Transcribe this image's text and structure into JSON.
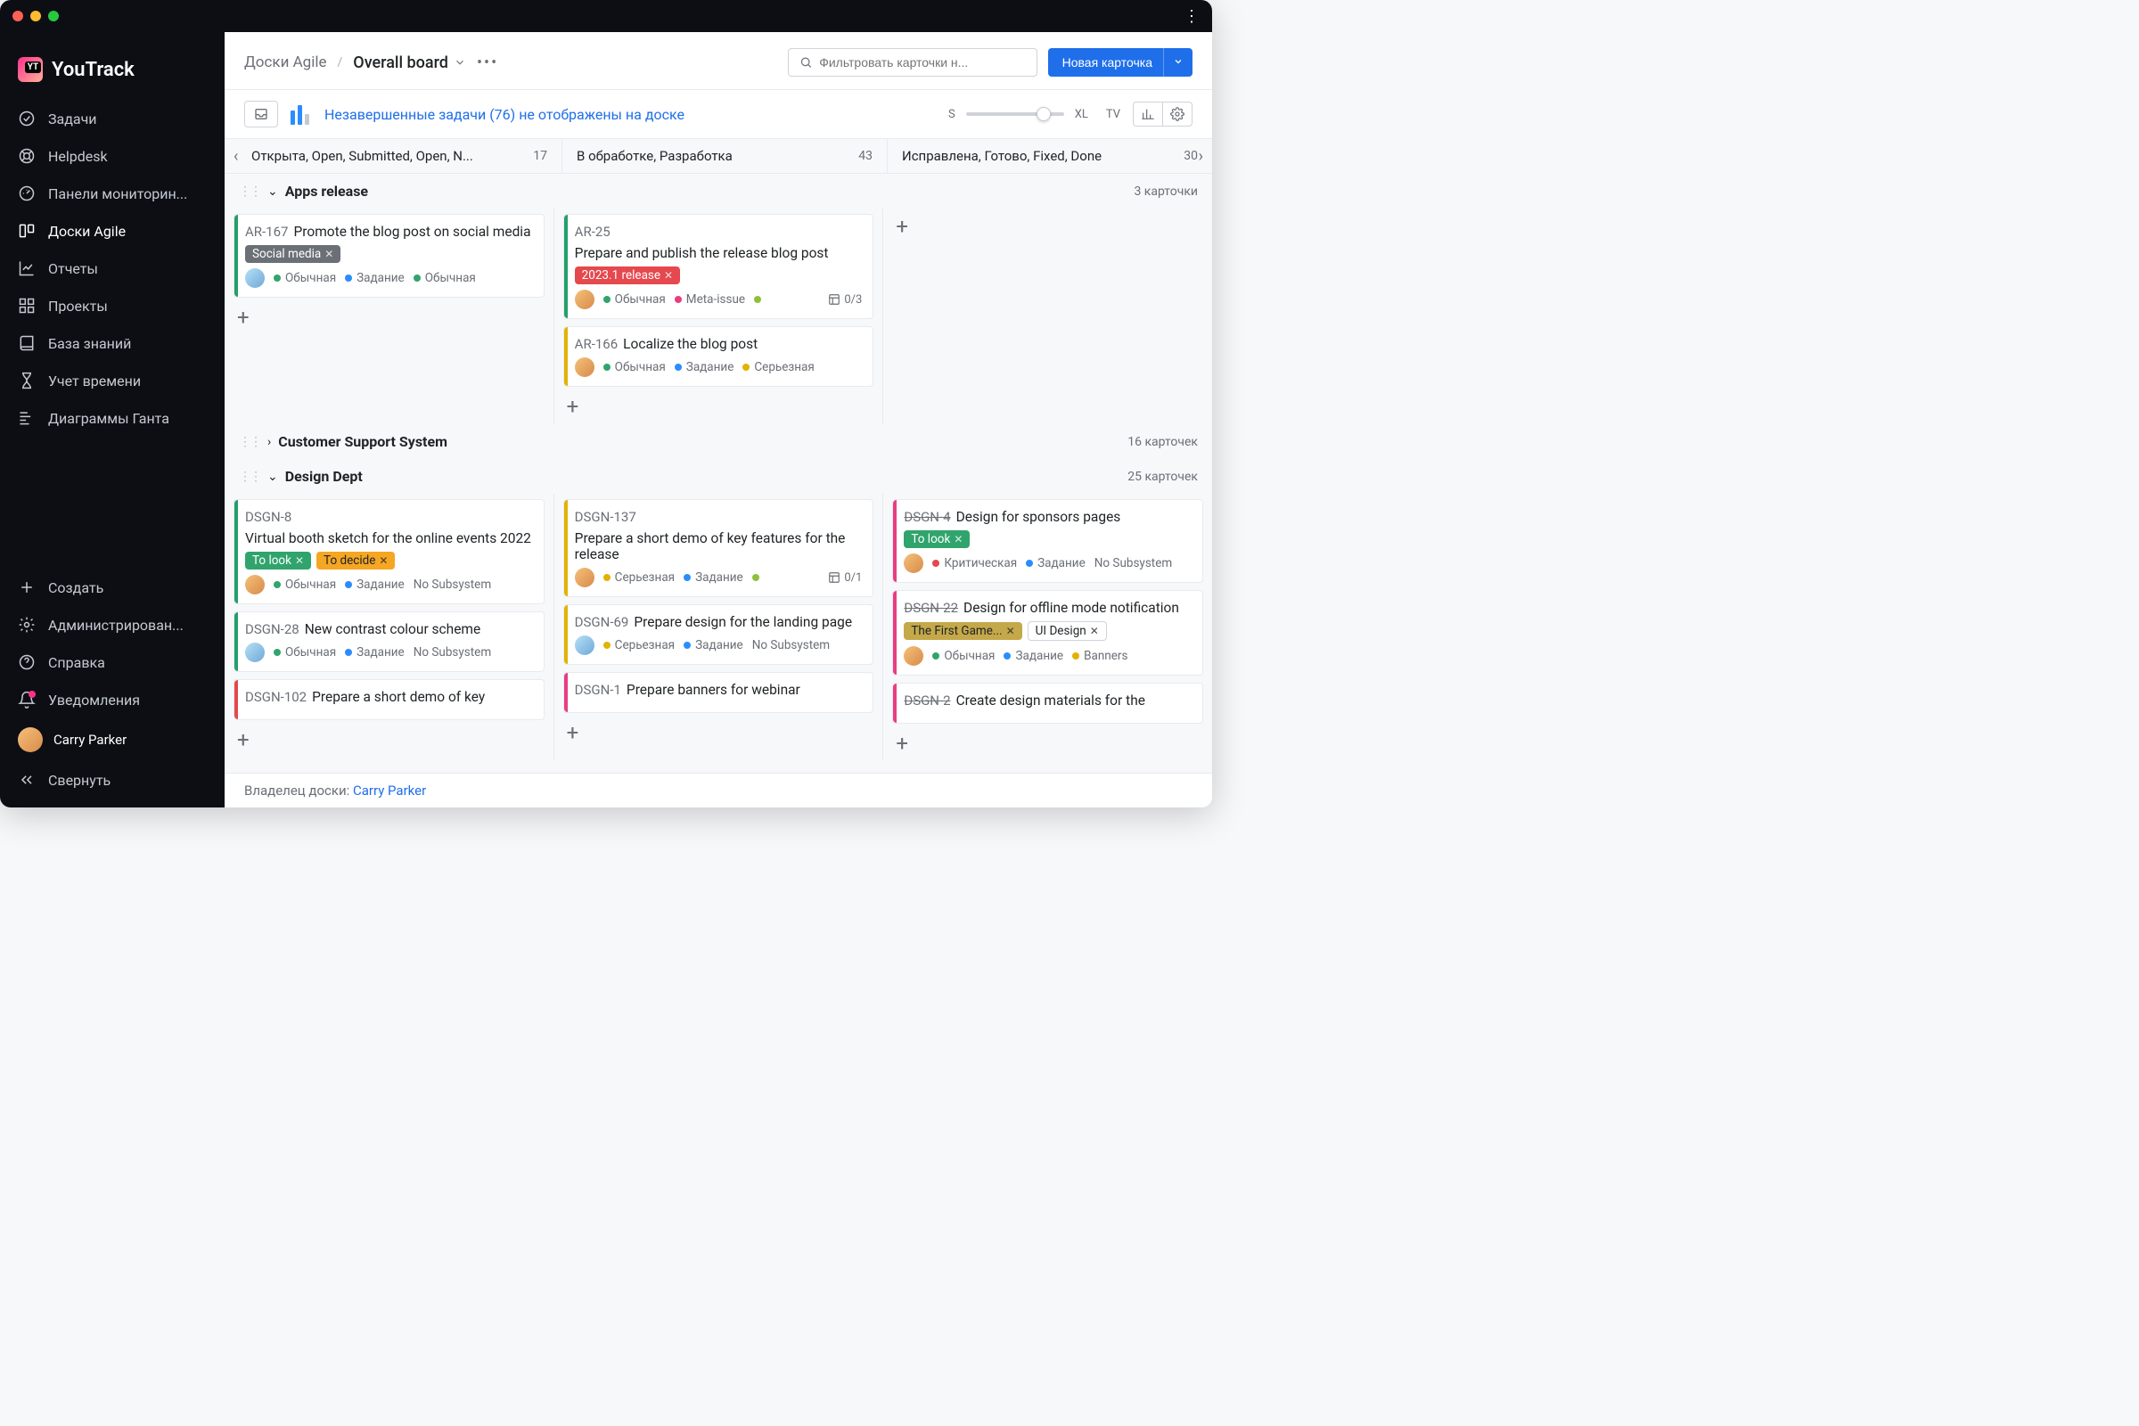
{
  "app": {
    "name": "YouTrack",
    "logo_badge": "YT"
  },
  "sidebar": {
    "items": [
      {
        "label": "Задачи",
        "icon": "check-circle"
      },
      {
        "label": "Helpdesk",
        "icon": "lifebuoy"
      },
      {
        "label": "Панели мониторин...",
        "icon": "gauge"
      },
      {
        "label": "Доски Agile",
        "icon": "board",
        "active": true
      },
      {
        "label": "Отчеты",
        "icon": "chart"
      },
      {
        "label": "Проекты",
        "icon": "grid"
      },
      {
        "label": "База знаний",
        "icon": "book"
      },
      {
        "label": "Учет времени",
        "icon": "hourglass"
      },
      {
        "label": "Диаграммы Ганта",
        "icon": "gantt"
      }
    ],
    "bottom": [
      {
        "label": "Создать",
        "icon": "plus"
      },
      {
        "label": "Администрирован...",
        "icon": "gear"
      },
      {
        "label": "Справка",
        "icon": "help"
      },
      {
        "label": "Уведомления",
        "icon": "bell",
        "badge": true
      }
    ],
    "user": {
      "name": "Carry Parker"
    },
    "collapse_label": "Свернуть"
  },
  "breadcrumb": {
    "root": "Доски Agile",
    "current": "Overall board"
  },
  "search": {
    "placeholder": "Фильтровать карточки н..."
  },
  "new_card_btn": "Новая карточка",
  "backlog_link": "Незавершенные задачи (76) не отображены на доске",
  "size_labels": {
    "s": "S",
    "xl": "XL",
    "tv": "TV"
  },
  "columns": [
    {
      "title": "Открыта, Open, Submitted, Open, N...",
      "count": 17
    },
    {
      "title": "В обработке, Разработка",
      "count": 43
    },
    {
      "title": "Исправлена, Готово, Fixed, Done",
      "count": 30
    }
  ],
  "swimlanes": [
    {
      "title": "Apps release",
      "count_label": "3 карточки",
      "expanded": true,
      "cols": [
        [
          {
            "id": "AR-167",
            "title": "Promote the blog post on social media",
            "stripe": "green",
            "tags": [
              {
                "text": "Social media",
                "cls": "tag-gray"
              }
            ],
            "meta": [
              {
                "dot": "green",
                "text": "Обычная"
              },
              {
                "dot": "blue",
                "text": "Задание"
              },
              {
                "dot": "green",
                "text": "Обычная"
              }
            ],
            "avatar": "cold"
          }
        ],
        [
          {
            "id": "AR-25",
            "title": "Prepare and publish the release blog post",
            "stripe": "green",
            "tags": [
              {
                "text": "2023.1 release",
                "cls": "tag-red"
              }
            ],
            "meta": [
              {
                "dot": "green",
                "text": "Обычная"
              },
              {
                "dot": "pink",
                "text": "Meta-issue"
              },
              {
                "dot": "lime",
                "text": ""
              }
            ],
            "avatar": "warm",
            "subtasks": "0/3"
          },
          {
            "id": "AR-166",
            "title": "Localize the blog post",
            "stripe": "yellow",
            "meta": [
              {
                "dot": "green",
                "text": "Обычная"
              },
              {
                "dot": "blue",
                "text": "Задание"
              },
              {
                "dot": "yellow",
                "text": "Серьезная"
              }
            ],
            "avatar": "warm"
          }
        ],
        []
      ]
    },
    {
      "title": "Customer Support System",
      "count_label": "16 карточек",
      "expanded": false
    },
    {
      "title": "Design Dept",
      "count_label": "25 карточек",
      "expanded": true,
      "cols": [
        [
          {
            "id": "DSGN-8",
            "title": "Virtual booth sketch for the online events 2022",
            "stripe": "green",
            "tags": [
              {
                "text": "To look",
                "cls": "tag-green"
              },
              {
                "text": "To decide",
                "cls": "tag-orange"
              }
            ],
            "meta": [
              {
                "dot": "green",
                "text": "Обычная"
              },
              {
                "dot": "blue",
                "text": "Задание"
              }
            ],
            "extra": "No Subsystem",
            "avatar": "warm"
          },
          {
            "id": "DSGN-28",
            "title": "New contrast colour scheme",
            "stripe": "green",
            "meta": [
              {
                "dot": "green",
                "text": "Обычная"
              },
              {
                "dot": "blue",
                "text": "Задание"
              }
            ],
            "extra": "No Subsystem",
            "avatar": "cold"
          },
          {
            "id": "DSGN-102",
            "title": "Prepare a short demo of key",
            "stripe": "red",
            "meta": []
          }
        ],
        [
          {
            "id": "DSGN-137",
            "title": "Prepare a short demo of key features for the release",
            "stripe": "yellow",
            "meta": [
              {
                "dot": "yellow",
                "text": "Серьезная"
              },
              {
                "dot": "blue",
                "text": "Задание"
              },
              {
                "dot": "lime",
                "text": ""
              }
            ],
            "avatar": "warm",
            "subtasks": "0/1"
          },
          {
            "id": "DSGN-69",
            "title": "Prepare design for the landing page",
            "stripe": "yellow",
            "meta": [
              {
                "dot": "yellow",
                "text": "Серьезная"
              },
              {
                "dot": "blue",
                "text": "Задание"
              }
            ],
            "extra": "No Subsystem",
            "avatar": "cold"
          },
          {
            "id": "DSGN-1",
            "title": "Prepare banners for webinar",
            "stripe": "pink",
            "meta": []
          }
        ],
        [
          {
            "id": "DSGN-4",
            "title": "Design for sponsors pages",
            "stripe": "pink",
            "strike": true,
            "tags": [
              {
                "text": "To look",
                "cls": "tag-green"
              }
            ],
            "meta": [
              {
                "dot": "red",
                "text": "Критическая"
              },
              {
                "dot": "blue",
                "text": "Задание"
              }
            ],
            "extra": "No Subsystem",
            "avatar": "warm"
          },
          {
            "id": "DSGN-22",
            "title": "Design for offline mode notification",
            "stripe": "pink",
            "strike": true,
            "tags": [
              {
                "text": "The First Game...",
                "cls": "tag-olive"
              },
              {
                "text": "UI Design",
                "cls": "tag-white"
              }
            ],
            "meta": [
              {
                "dot": "green",
                "text": "Обычная"
              },
              {
                "dot": "blue",
                "text": "Задание"
              },
              {
                "dot": "yellow",
                "text": "Banners"
              }
            ],
            "avatar": "warm"
          },
          {
            "id": "DSGN-2",
            "title": "Create design materials for the",
            "stripe": "pink",
            "strike": true,
            "meta": []
          }
        ]
      ]
    }
  ],
  "footer": {
    "label": "Владелец доски: ",
    "owner": "Carry Parker"
  }
}
